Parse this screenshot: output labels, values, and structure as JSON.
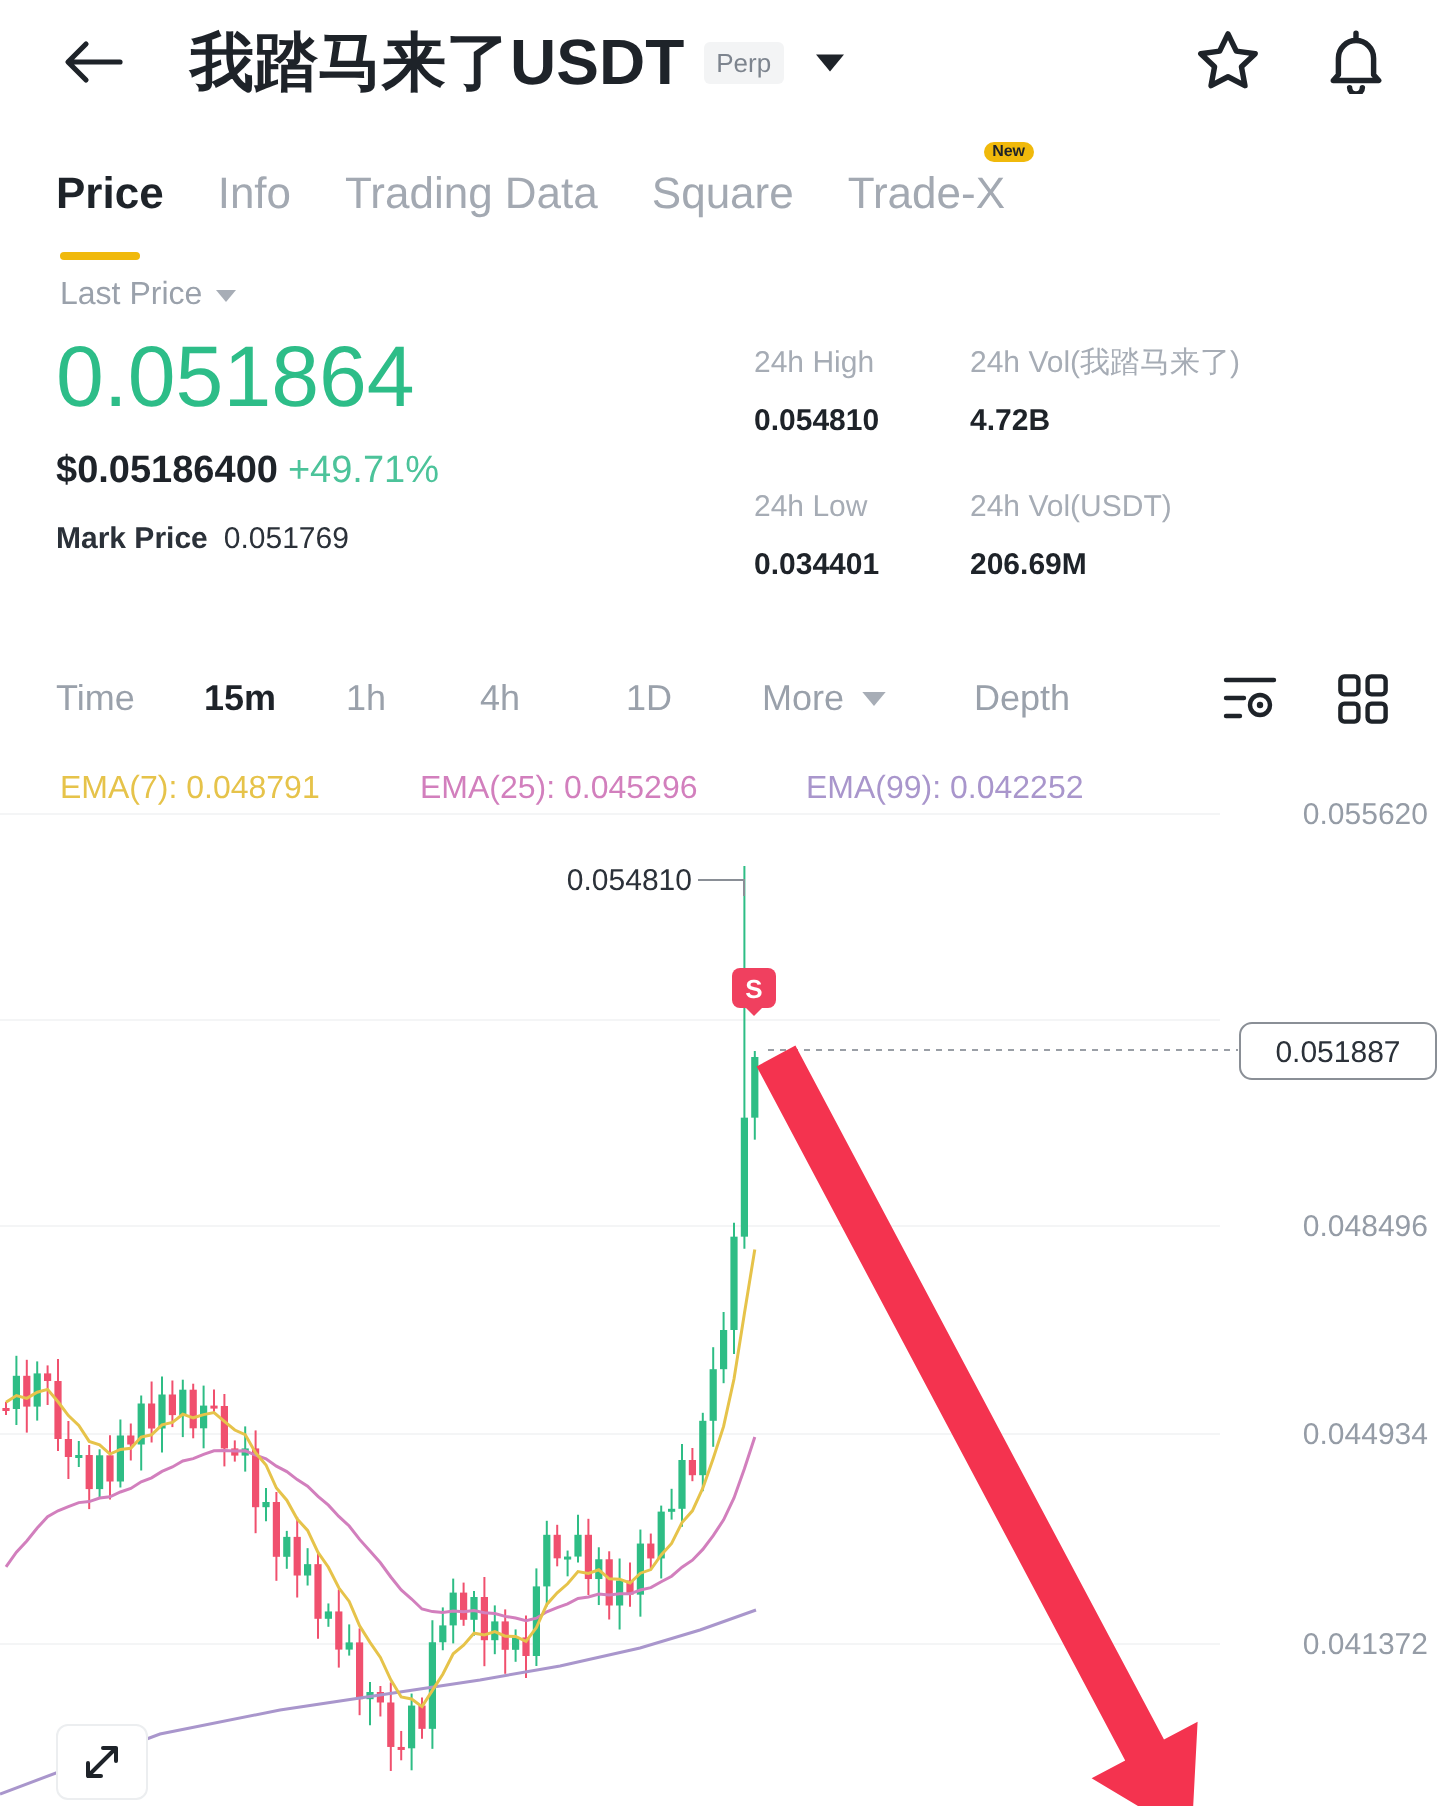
{
  "header": {
    "title": "我踏马来了USDT",
    "badge": "Perp"
  },
  "tabs": [
    {
      "label": "Price",
      "selected": true
    },
    {
      "label": "Info",
      "selected": false
    },
    {
      "label": "Trading Data",
      "selected": false
    },
    {
      "label": "Square",
      "selected": false
    },
    {
      "label": "Trade-X",
      "selected": false,
      "badge": "New"
    }
  ],
  "price": {
    "label": "Last Price",
    "last": "0.051864",
    "usd": "$0.05186400",
    "change": "+49.71%",
    "mark_label": "Mark Price",
    "mark": "0.051769"
  },
  "stats": [
    {
      "label": "24h High",
      "value": "0.054810"
    },
    {
      "label": "24h Vol(我踏马来了)",
      "value": "4.72B"
    },
    {
      "label": "24h Low",
      "value": "0.034401"
    },
    {
      "label": "24h Vol(USDT)",
      "value": "206.69M"
    }
  ],
  "intervals": [
    {
      "label": "Time",
      "kind": "option",
      "selected": false
    },
    {
      "label": "15m",
      "kind": "option",
      "selected": true
    },
    {
      "label": "1h",
      "kind": "option",
      "selected": false
    },
    {
      "label": "4h",
      "kind": "option",
      "selected": false
    },
    {
      "label": "1D",
      "kind": "option",
      "selected": false
    },
    {
      "label": "More",
      "kind": "dropdown",
      "selected": false
    },
    {
      "label": "Depth",
      "kind": "option",
      "selected": false
    }
  ],
  "indicators": [
    {
      "label": "EMA(7): 0.048791",
      "color": "#e6c34a"
    },
    {
      "label": "EMA(25): 0.045296",
      "color": "#d27fbd"
    },
    {
      "label": "EMA(99): 0.042252",
      "color": "#a996cc"
    }
  ],
  "chart": {
    "axis_labels": [
      "0.055620",
      "0.048496",
      "0.044934",
      "0.041372"
    ],
    "high_label": "0.054810",
    "signal": "S",
    "current_price": "0.051887"
  }
}
